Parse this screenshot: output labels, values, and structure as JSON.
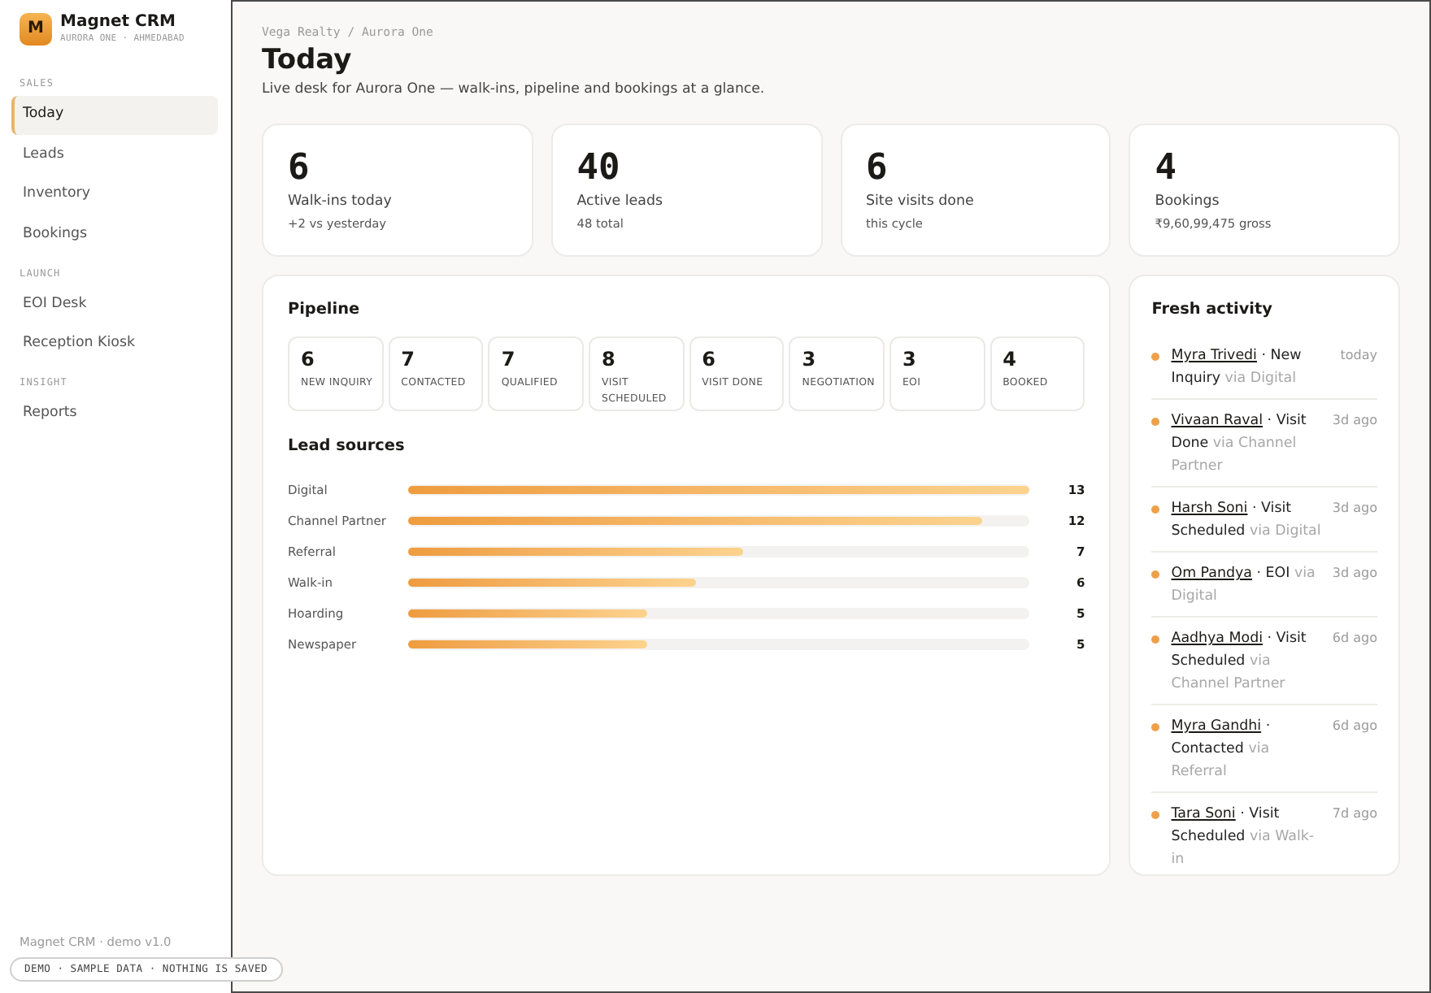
{
  "sidebar": {
    "brand": {
      "logo_letter": "M",
      "name": "Magnet CRM",
      "subtitle": "AURORA ONE · AHMEDABAD"
    },
    "sections": [
      {
        "label": "SALES",
        "items": [
          {
            "label": "Today",
            "selected": true
          },
          {
            "label": "Leads",
            "selected": false
          },
          {
            "label": "Inventory",
            "selected": false
          },
          {
            "label": "Bookings",
            "selected": false
          }
        ]
      },
      {
        "label": "LAUNCH",
        "items": [
          {
            "label": "EOI Desk",
            "selected": false
          },
          {
            "label": "Reception Kiosk",
            "selected": false
          }
        ]
      },
      {
        "label": "INSIGHT",
        "items": [
          {
            "label": "Reports",
            "selected": false
          }
        ]
      }
    ],
    "footer": "Magnet CRM · demo v1.0"
  },
  "demo_badge": "DEMO · SAMPLE DATA · NOTHING IS SAVED",
  "header": {
    "breadcrumb": "Vega Realty / Aurora One",
    "title": "Today",
    "subtitle": "Live desk for Aurora One — walk-ins, pipeline and bookings at a glance."
  },
  "stats": [
    {
      "value": "6",
      "label": "Walk-ins today",
      "note": "+2 vs yesterday"
    },
    {
      "value": "40",
      "label": "Active leads",
      "note": "48 total"
    },
    {
      "value": "6",
      "label": "Site visits done",
      "note": "this cycle"
    },
    {
      "value": "4",
      "label": "Bookings",
      "note": "₹9,60,99,475 gross"
    }
  ],
  "pipeline": {
    "title": "Pipeline",
    "stages": [
      {
        "count": "6",
        "label": "NEW INQUIRY"
      },
      {
        "count": "7",
        "label": "CONTACTED"
      },
      {
        "count": "7",
        "label": "QUALIFIED"
      },
      {
        "count": "8",
        "label": "VISIT SCHEDULED"
      },
      {
        "count": "6",
        "label": "VISIT DONE"
      },
      {
        "count": "3",
        "label": "NEGOTIATION"
      },
      {
        "count": "3",
        "label": "EOI"
      },
      {
        "count": "4",
        "label": "BOOKED"
      }
    ]
  },
  "lead_sources": {
    "title": "Lead sources",
    "rows": [
      {
        "name": "Digital",
        "level": 1,
        "count": "13"
      },
      {
        "name": "Channel Partner",
        "level": 0.923,
        "count": "12"
      },
      {
        "name": "Referral",
        "level": 0.538,
        "count": "7"
      },
      {
        "name": "Walk-in",
        "level": 0.462,
        "count": "6"
      },
      {
        "name": "Hoarding",
        "level": 0.385,
        "count": "5"
      },
      {
        "name": "Newspaper",
        "level": 0.385,
        "count": "5"
      }
    ]
  },
  "activity": {
    "title": "Fresh activity",
    "items": [
      {
        "name": "Myra Trivedi",
        "event": "· New Inquiry",
        "via": "via Digital",
        "time": "today"
      },
      {
        "name": "Vivaan Raval",
        "event": "· Visit Done",
        "via": "via Channel Partner",
        "time": "3d ago"
      },
      {
        "name": "Harsh Soni",
        "event": "· Visit Scheduled",
        "via": "via Digital",
        "time": "3d ago"
      },
      {
        "name": "Om Pandya",
        "event": "· EOI",
        "via": "via Digital",
        "time": "3d ago"
      },
      {
        "name": "Aadhya Modi",
        "event": "· Visit Scheduled",
        "via": "via Channel Partner",
        "time": "6d ago"
      },
      {
        "name": "Myra Gandhi",
        "event": "· Contacted",
        "via": "via Referral",
        "time": "6d ago"
      },
      {
        "name": "Tara Soni",
        "event": "· Visit Scheduled",
        "via": "via Walk-in",
        "time": "7d ago"
      }
    ]
  }
}
